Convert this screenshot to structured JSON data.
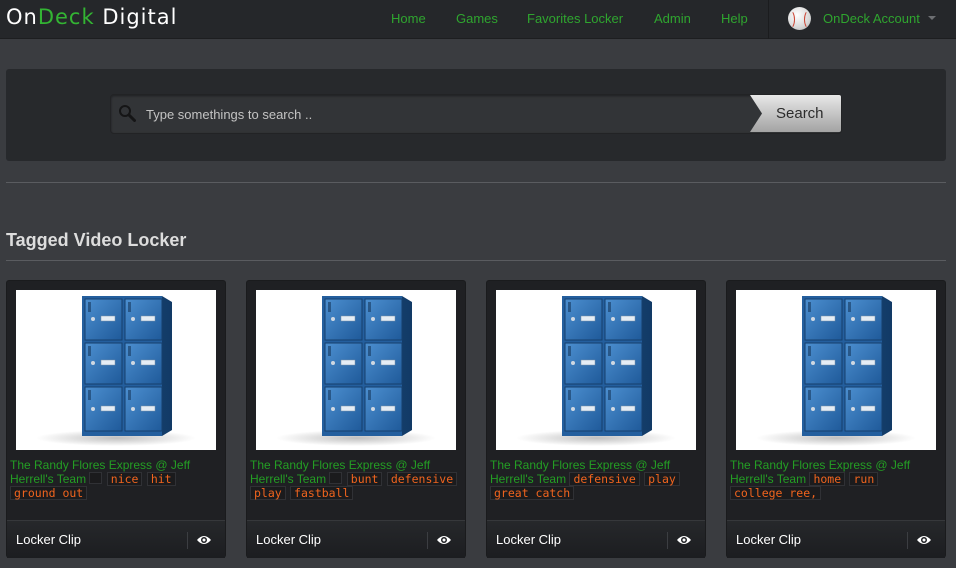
{
  "brand": {
    "part1": "On",
    "part2": "Deck",
    "part3": " Digital"
  },
  "nav": {
    "links": [
      "Home",
      "Games",
      "Favorites Locker",
      "Admin",
      "Help"
    ],
    "account_label": "OnDeck Account"
  },
  "search": {
    "placeholder": "Type somethings to search ..",
    "value": "",
    "button_label": "Search"
  },
  "section_title": "Tagged Video Locker",
  "cards": [
    {
      "title": "The Randy Flores Express @ Jeff Herrell's Team",
      "tags": [
        "",
        "nice",
        "hit",
        "ground out"
      ],
      "footer_label": "Locker Clip"
    },
    {
      "title": "The Randy Flores Express @ Jeff Herrell's Team",
      "tags": [
        "",
        "bunt",
        "defensive",
        "play",
        "fastball"
      ],
      "footer_label": "Locker Clip"
    },
    {
      "title": "The Randy Flores Express @ Jeff Herrell's Team",
      "tags": [
        "defensive",
        "play",
        "great catch"
      ],
      "footer_label": "Locker Clip"
    },
    {
      "title": "The Randy Flores Express @ Jeff Herrell's Team",
      "tags": [
        "home",
        "run",
        "college ree,"
      ],
      "footer_label": "Locker Clip"
    }
  ],
  "colors": {
    "brand_green": "#33b433",
    "link_green": "#2fa52f",
    "tag_orange": "#f0641e",
    "background": "#3a3c40"
  },
  "icons": {
    "search": "search-icon",
    "eye": "eye-icon",
    "account": "baseball-avatar",
    "dropdown": "chevron-down-icon"
  }
}
